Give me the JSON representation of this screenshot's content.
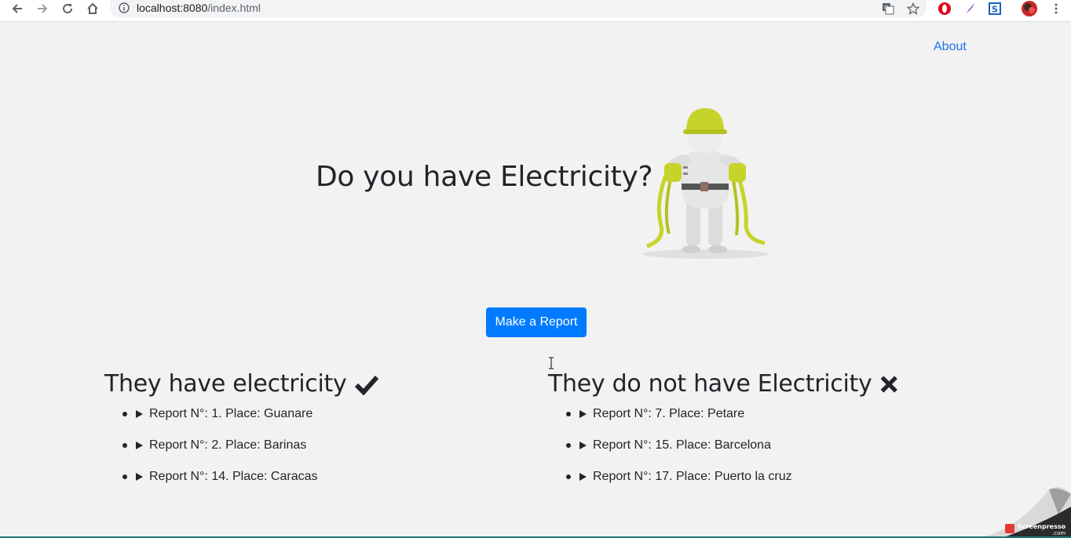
{
  "browser": {
    "url_host": "localhost:8080",
    "url_path": "/index.html",
    "icons": [
      "back-icon",
      "forward-icon",
      "reload-icon",
      "home-icon",
      "info-icon",
      "translate-icon",
      "star-icon",
      "opera-extension-icon",
      "feather-extension-icon",
      "s-extension-icon",
      "profile-avatar",
      "menu-icon"
    ]
  },
  "nav": {
    "about_label": "About"
  },
  "hero": {
    "title": "Do you have Electricity?",
    "image": "electrician-figure-with-cables"
  },
  "actions": {
    "report_button_label": "Make a Report",
    "button_color": "#007bff"
  },
  "have_electricity": {
    "title": "They have electricity",
    "icon": "check-icon",
    "reports": [
      {
        "label": "Report N°: 1. Place: Guanare"
      },
      {
        "label": "Report N°: 2. Place: Barinas"
      },
      {
        "label": "Report N°: 14. Place: Caracas"
      }
    ]
  },
  "no_electricity": {
    "title": "They do not have Electricity",
    "icon": "x-icon",
    "reports": [
      {
        "label": "Report N°: 7. Place: Petare"
      },
      {
        "label": "Report N°: 15. Place: Barcelona"
      },
      {
        "label": "Report N°: 17. Place: Puerto la cruz"
      }
    ]
  },
  "watermark": {
    "text": "Screenpresso"
  }
}
